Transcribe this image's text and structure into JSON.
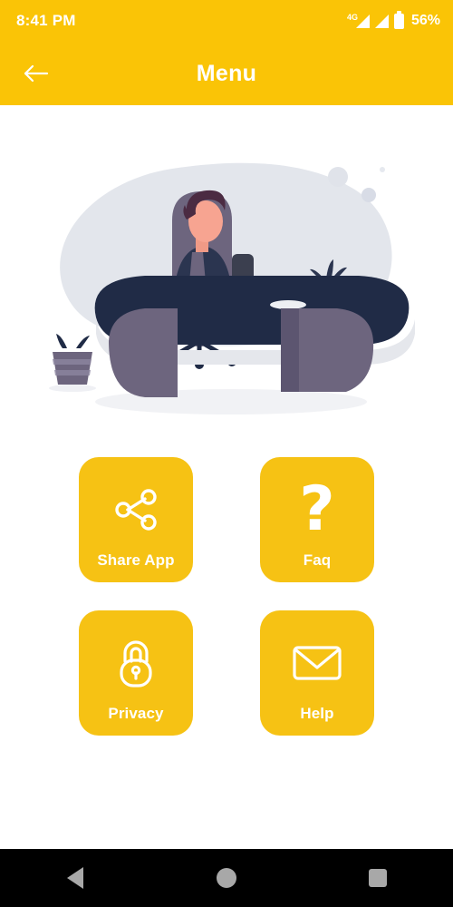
{
  "status_bar": {
    "time": "8:41 PM",
    "network_type": "4G",
    "battery_percent": "56%",
    "icons": [
      "signal-4g-icon",
      "signal-icon",
      "battery-icon"
    ]
  },
  "app_bar": {
    "title": "Menu",
    "back_icon": "arrow-left-icon"
  },
  "illustration": {
    "name": "person-at-desk-illustration",
    "alt": "Flat illustration of a person working at a curved desk with office chair and plants"
  },
  "menu": {
    "items": [
      {
        "id": "share-app",
        "label": "Share App",
        "icon": "share-icon"
      },
      {
        "id": "faq",
        "label": "Faq",
        "icon": "question-mark-icon",
        "glyph": "?"
      },
      {
        "id": "privacy",
        "label": "Privacy",
        "icon": "lock-icon"
      },
      {
        "id": "help",
        "label": "Help",
        "icon": "mail-icon"
      }
    ]
  },
  "nav_bar": {
    "buttons": [
      {
        "id": "back",
        "icon": "nav-back-triangle-icon"
      },
      {
        "id": "home",
        "icon": "nav-home-circle-icon"
      },
      {
        "id": "recent",
        "icon": "nav-recents-square-icon"
      }
    ]
  },
  "colors": {
    "brand_yellow": "#FAC406",
    "card_yellow": "#F6C214",
    "white": "#FFFFFF",
    "nav_black": "#000000",
    "nav_icon_grey": "#A8A8A8",
    "illustration_blob": "#E3E6EC",
    "illustration_dark_navy": "#202B46",
    "illustration_purple_grey": "#635B77",
    "illustration_skin": "#F7A491",
    "illustration_hair": "#4B2B42"
  }
}
